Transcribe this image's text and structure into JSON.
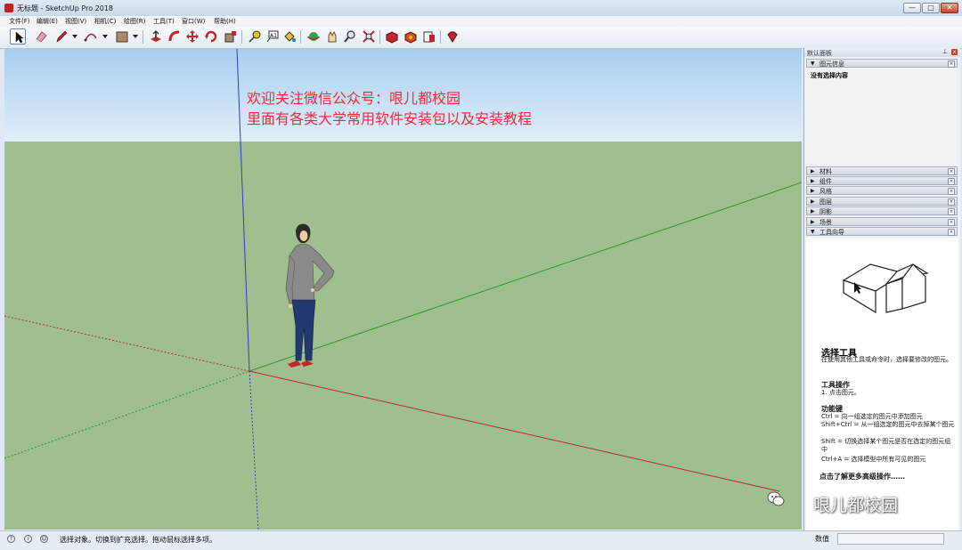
{
  "window": {
    "title": "无标题 - SketchUp Pro 2018",
    "controls": {
      "minimize": "—",
      "maximize": "□",
      "close": "✕"
    }
  },
  "menu": [
    "文件(F)",
    "编辑(E)",
    "视图(V)",
    "相机(C)",
    "绘图(R)",
    "工具(T)",
    "窗口(W)",
    "帮助(H)"
  ],
  "toolbar": {
    "icons": [
      "select-icon",
      "eraser-icon",
      "pencil-icon",
      "arc-icon",
      "rectangle-icon",
      "pushpull-icon",
      "followme-icon",
      "move-icon",
      "rotate-icon",
      "scale-icon",
      "tape-measure-icon",
      "text-icon",
      "paint-bucket-icon",
      "orbit-icon",
      "pan-icon",
      "zoom-icon",
      "zoom-extents-icon",
      "warehouse-icon",
      "extension-warehouse-icon",
      "layout-icon",
      "ruby-icon"
    ]
  },
  "viewport": {
    "watermark_line1": "欢迎关注微信公众号：哏儿都校园",
    "watermark_line2": "里面有各类大学常用软件安装包以及安装教程",
    "colors": {
      "sky": "#c8e2f5",
      "ground": "#9fc08e",
      "red_axis": "#c0262a",
      "green_axis": "#2d9a2d",
      "blue_axis": "#2f3fc6"
    }
  },
  "panel": {
    "header": "默认面板",
    "entity_info": {
      "title": "图元信息",
      "content": "没有选择内容"
    },
    "trays": [
      "材料",
      "组件",
      "风格",
      "图层",
      "阴影",
      "场景"
    ],
    "instructor": {
      "tray_label": "工具向导",
      "title": "选择工具",
      "intro": "在使用其他工具或命令时，选择要修改的图元。",
      "ops_heading": "工具操作",
      "ops_item": "1. 点击图元。",
      "keys_heading": "功能键",
      "keys": [
        "Ctrl = 向一组选定的图元中添加图元",
        "Shift+Ctrl = 从一组选定的图元中去掉某个图元",
        "Shift = 切换选择某个图元是否在选定的图元组中",
        "Ctrl+A = 选择模型中所有可见的图元"
      ],
      "more_link": "点击了解更多高级操作……"
    }
  },
  "brand": "哏儿都校园",
  "status": {
    "text": "选择对象。切换到扩充选择。拖动鼠标选择多项。",
    "measure_label": "数值",
    "icon_labels": [
      "?",
      "i",
      "☺"
    ]
  }
}
